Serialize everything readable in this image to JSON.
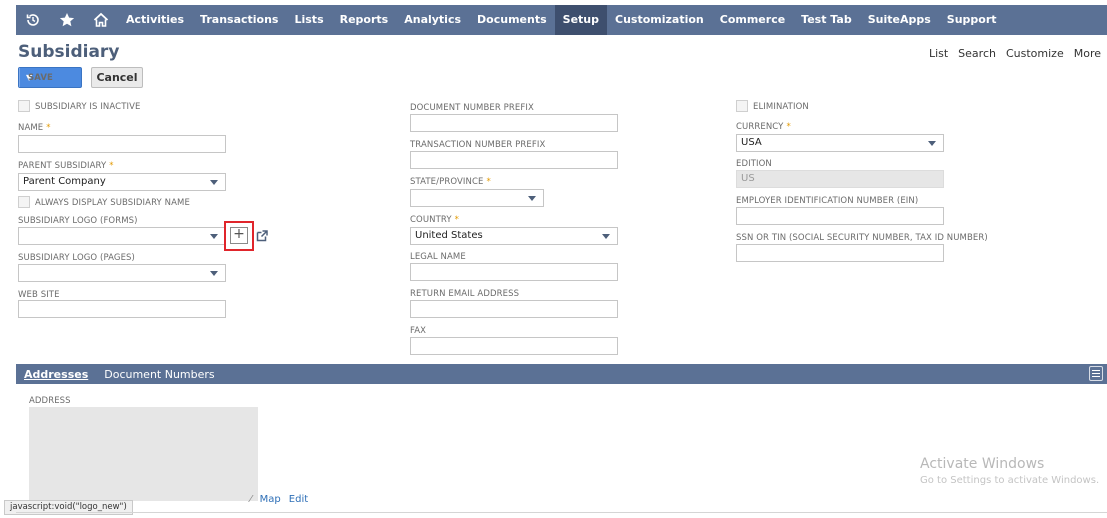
{
  "nav": {
    "icons": [
      "history-icon",
      "star-icon",
      "home-icon"
    ],
    "items": [
      "Activities",
      "Transactions",
      "Lists",
      "Reports",
      "Analytics",
      "Documents",
      "Setup",
      "Customization",
      "Commerce",
      "Test Tab",
      "SuiteApps",
      "Support"
    ],
    "active": "Setup"
  },
  "page": {
    "title": "Subsidiary",
    "links": [
      "List",
      "Search",
      "Customize",
      "More"
    ]
  },
  "buttons": {
    "save": "Save",
    "cancel": "Cancel"
  },
  "form": {
    "subsidiary_inactive": "SUBSIDIARY IS INACTIVE",
    "name_label": "NAME",
    "parent_label": "PARENT SUBSIDIARY",
    "parent_value": "Parent Company",
    "always_display": "ALWAYS DISPLAY SUBSIDIARY NAME",
    "logo_forms_label": "SUBSIDIARY LOGO (FORMS)",
    "logo_pages_label": "SUBSIDIARY LOGO (PAGES)",
    "web_site_label": "WEB SITE",
    "doc_prefix_label": "DOCUMENT NUMBER PREFIX",
    "txn_prefix_label": "TRANSACTION NUMBER PREFIX",
    "state_label": "STATE/PROVINCE",
    "country_label": "COUNTRY",
    "country_value": "United States",
    "legal_name_label": "LEGAL NAME",
    "return_email_label": "RETURN EMAIL ADDRESS",
    "fax_label": "FAX",
    "elimination_label": "ELIMINATION",
    "currency_label": "CURRENCY",
    "currency_value": "USA",
    "edition_label": "EDITION",
    "edition_value": "US",
    "ein_label": "EMPLOYER IDENTIFICATION NUMBER (EIN)",
    "ssn_label": "SSN OR TIN (SOCIAL SECURITY NUMBER, TAX ID NUMBER)",
    "required_mark": "*",
    "plus": "+"
  },
  "subtabs": {
    "addresses": "Addresses",
    "doc_numbers": "Document Numbers"
  },
  "address": {
    "label": "ADDRESS",
    "map": "Map",
    "edit": "Edit",
    "resize_glyph": "⁄"
  },
  "watermark": {
    "title": "Activate Windows",
    "subtitle": "Go to Settings to activate Windows."
  },
  "status_bar": "javascript:void(\"logo_new\")",
  "colors": {
    "nav_bg": "#5b7195",
    "nav_active": "#3e4f6e",
    "save_bg": "#4c8ae0",
    "highlight": "#e0252b",
    "required": "#e39a00"
  }
}
